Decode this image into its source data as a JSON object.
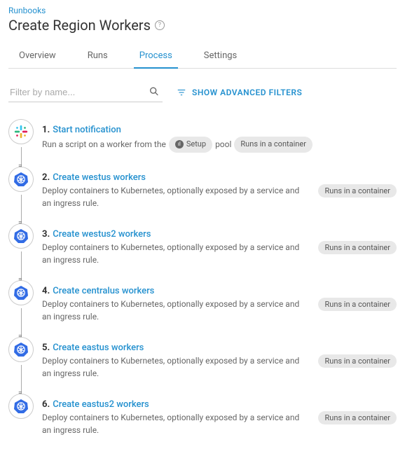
{
  "breadcrumb": "Runbooks",
  "title": "Create Region Workers",
  "tabs": [
    "Overview",
    "Runs",
    "Process",
    "Settings"
  ],
  "activeTabIndex": 2,
  "filter": {
    "placeholder": "Filter by name...",
    "value": ""
  },
  "advancedFiltersLabel": "SHOW ADVANCED FILTERS",
  "poolLabel": "pool",
  "runsInContainerLabel": "Runs in a container",
  "setupPoolLabel": "Setup",
  "steps": [
    {
      "num": "1.",
      "title": "Start notification",
      "desc_pre": "Run a script on a worker from the",
      "desc_post": "",
      "icon": "slack",
      "hasPool": true,
      "connector": ""
    },
    {
      "num": "2.",
      "title": "Create westus workers",
      "desc_pre": "Deploy containers to Kubernetes, optionally exposed by a service and an ingress rule.",
      "desc_post": "",
      "icon": "k8s",
      "hasPool": false,
      "connector": "="
    },
    {
      "num": "3.",
      "title": "Create westus2 workers",
      "desc_pre": "Deploy containers to Kubernetes, optionally exposed by a service and an ingress rule.",
      "desc_post": "",
      "icon": "k8s",
      "hasPool": false,
      "connector": "="
    },
    {
      "num": "4.",
      "title": "Create centralus workers",
      "desc_pre": "Deploy containers to Kubernetes, optionally exposed by a service and an ingress rule.",
      "desc_post": "",
      "icon": "k8s",
      "hasPool": false,
      "connector": "="
    },
    {
      "num": "5.",
      "title": "Create eastus workers",
      "desc_pre": "Deploy containers to Kubernetes, optionally exposed by a service and an ingress rule.",
      "desc_post": "",
      "icon": "k8s",
      "hasPool": false,
      "connector": "="
    },
    {
      "num": "6.",
      "title": "Create eastus2 workers",
      "desc_pre": "Deploy containers to Kubernetes, optionally exposed by a service and an ingress rule.",
      "desc_post": "",
      "icon": "k8s",
      "hasPool": false,
      "connector": "="
    }
  ]
}
